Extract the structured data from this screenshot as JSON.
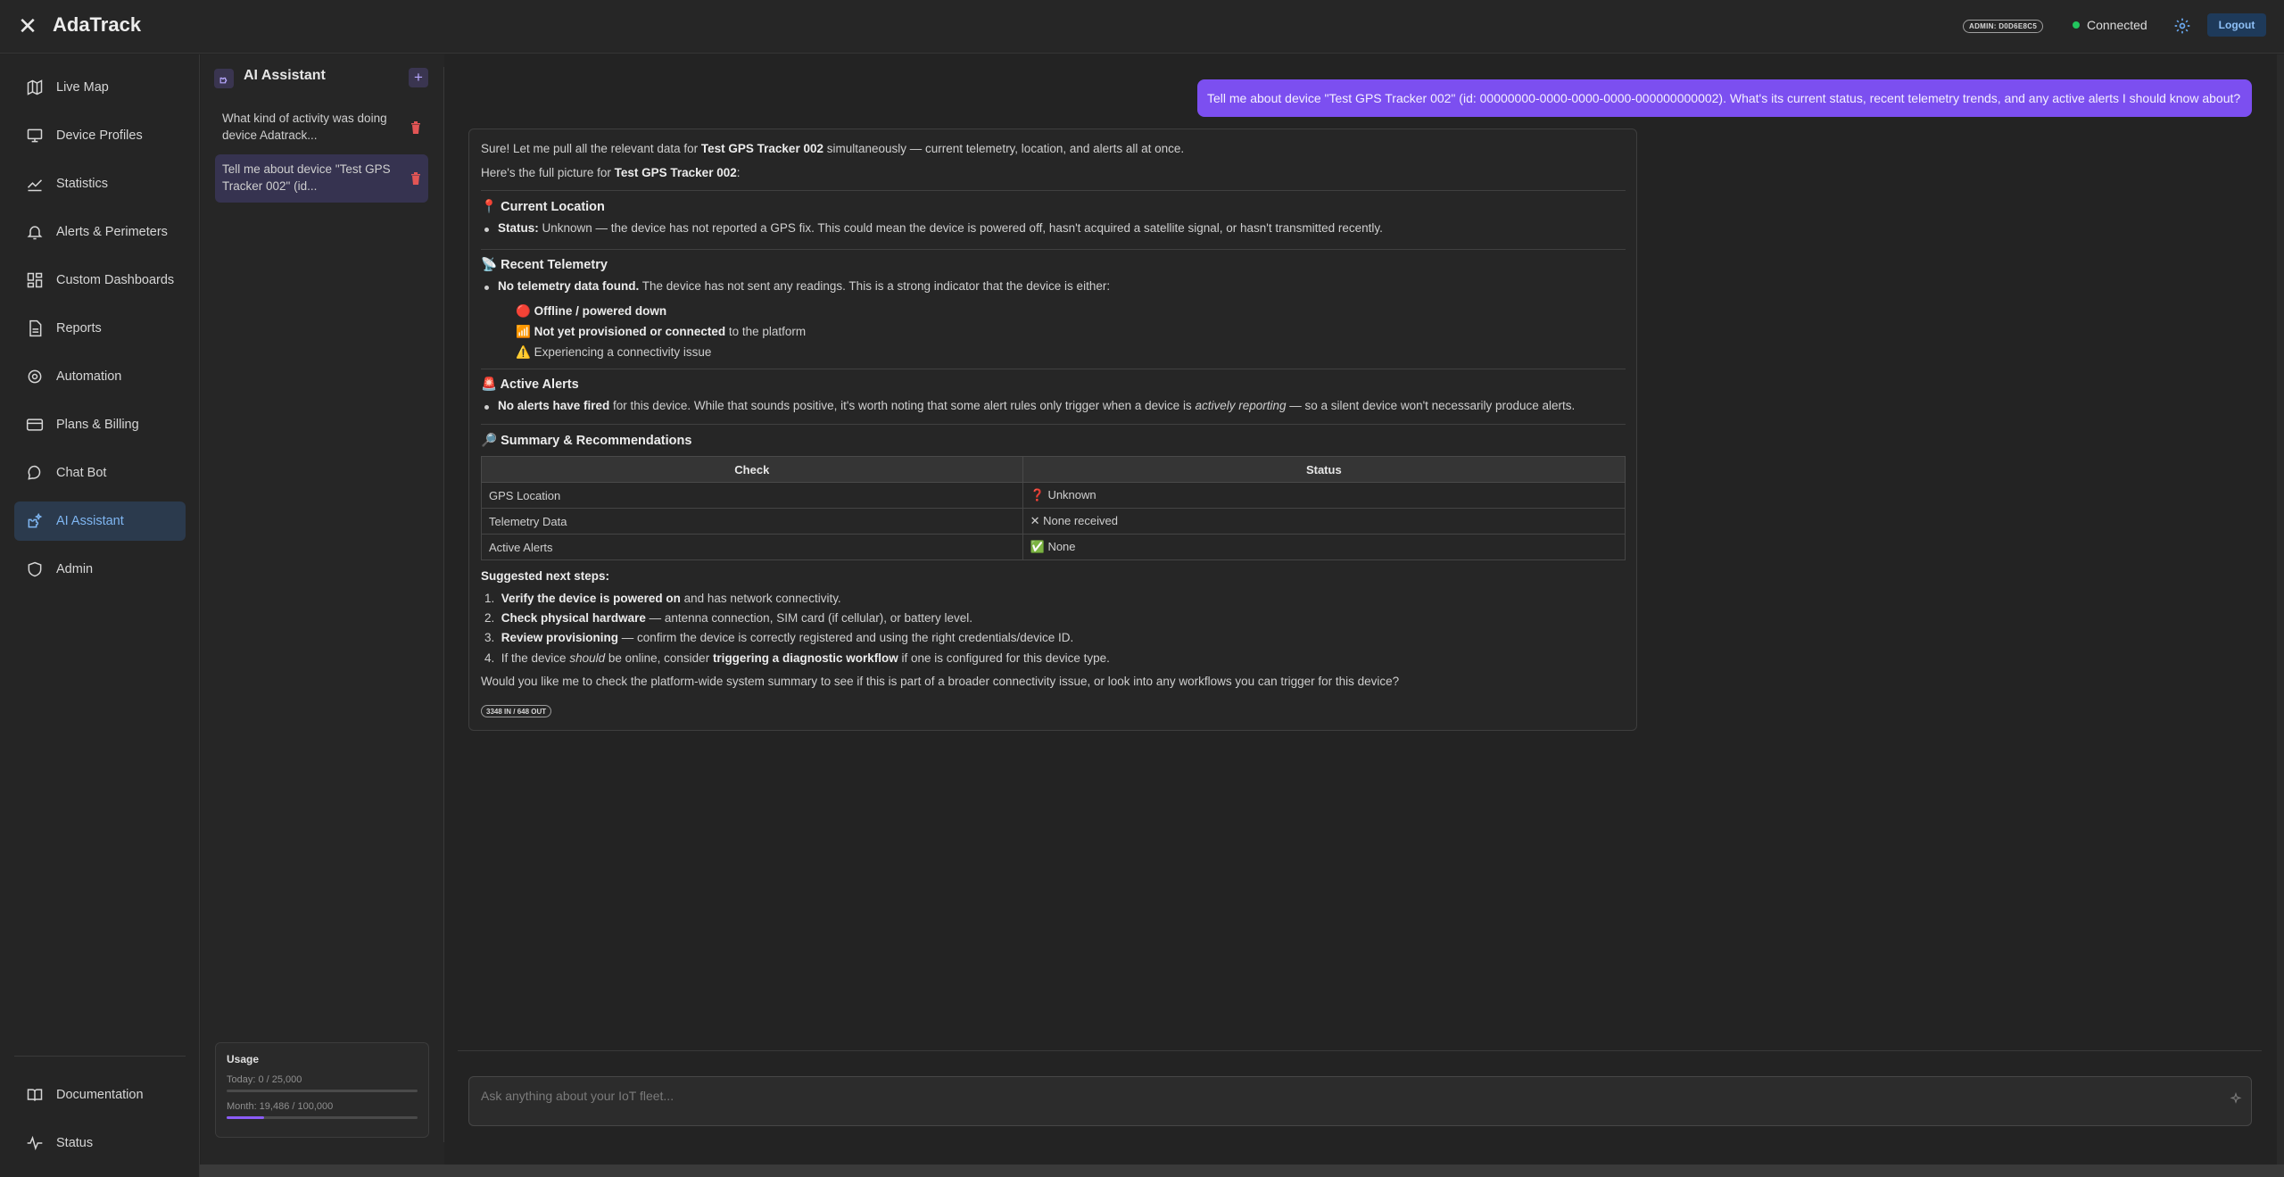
{
  "app": {
    "title": "AdaTrack"
  },
  "header": {
    "admin_badge": "ADMIN: D0D6E8C5",
    "connection_status": "Connected",
    "logout_label": "Logout",
    "accent_color": "#7c4ff0",
    "connected_color": "#22c55e"
  },
  "nav": {
    "items": [
      {
        "label": "Live Map",
        "icon": "map-icon"
      },
      {
        "label": "Device Profiles",
        "icon": "monitor-icon"
      },
      {
        "label": "Statistics",
        "icon": "trend-chart-icon"
      },
      {
        "label": "Alerts & Perimeters",
        "icon": "bell-icon"
      },
      {
        "label": "Custom Dashboards",
        "icon": "dashboard-grid-icon"
      },
      {
        "label": "Reports",
        "icon": "document-icon"
      },
      {
        "label": "Automation",
        "icon": "gear-cog-icon"
      },
      {
        "label": "Plans & Billing",
        "icon": "credit-card-icon"
      },
      {
        "label": "Chat Bot",
        "icon": "bot-icon"
      },
      {
        "label": "AI Assistant",
        "icon": "sparkle-puzzle-icon",
        "active": true
      },
      {
        "label": "Admin",
        "icon": "admin-shield-icon"
      }
    ],
    "bottom": [
      {
        "label": "Documentation",
        "icon": "book-icon"
      },
      {
        "label": "Status",
        "icon": "activity-pulse-icon"
      }
    ]
  },
  "conversations": {
    "title": "AI Assistant",
    "items": [
      {
        "line1": "What kind of activity was doing",
        "line2": "device Adatrack..."
      },
      {
        "line1": "Tell me about device \"Test GPS",
        "line2": "Tracker 002\" (id...",
        "active": true
      }
    ]
  },
  "usage": {
    "title": "Usage",
    "today": "Today: 0 / 25,000",
    "today_fraction": 0,
    "month": "Month: 19,486 / 100,000",
    "month_fraction": 0.19486
  },
  "chat": {
    "user_message": "Tell me about device \"Test GPS Tracker 002\" (id: 00000000-0000-0000-0000-000000000002). What's its current status, recent telemetry trends, and any active alerts I should know about?",
    "reply": {
      "intro_1a": "Sure! Let me pull all the relevant data for ",
      "intro_1b": "Test GPS Tracker 002",
      "intro_1c": " simultaneously — current telemetry, location, and alerts all at once.",
      "intro_2a": "Here's the full picture for ",
      "intro_2b": "Test GPS Tracker 002",
      "intro_2c": ":",
      "loc_emoji": "📍",
      "loc_heading": "Current Location",
      "loc_label": "Status:",
      "loc_text": " Unknown — the device has not reported a GPS fix. This could mean the device is powered off, hasn't acquired a satellite signal, or hasn't transmitted recently.",
      "tel_emoji": "📡",
      "tel_heading": "Recent Telemetry",
      "tel_bold": "No telemetry data found.",
      "tel_text": " The device has not sent any readings. This is a strong indicator that the device is either:",
      "tel_sub1_emoji": "🔴",
      "tel_sub1": "Offline / powered down",
      "tel_sub2_emoji": "📶",
      "tel_sub2_bold": "Not yet provisioned or connected",
      "tel_sub2_text": " to the platform",
      "tel_sub3_emoji": "⚠️",
      "tel_sub3": "Experiencing a connectivity issue",
      "alert_emoji": "🚨",
      "alert_heading": "Active Alerts",
      "alert_bold": "No alerts have fired",
      "alert_text_a": " for this device. While that sounds positive, it's worth noting that some alert rules only trigger when a device is ",
      "alert_italic": "actively reporting",
      "alert_text_b": " — so a silent device won't necessarily produce alerts.",
      "sum_emoji": "🔎",
      "sum_heading": "Summary & Recommendations",
      "table": {
        "headers": [
          "Check",
          "Status"
        ],
        "rows": [
          [
            "GPS Location",
            "❓ Unknown"
          ],
          [
            "Telemetry Data",
            "✕ None received"
          ],
          [
            "Active Alerts",
            "✅ None"
          ]
        ]
      },
      "steps_heading": "Suggested next steps:",
      "step1_bold": "Verify the device is powered on",
      "step1_text": " and has network connectivity.",
      "step2_bold": "Check physical hardware",
      "step2_text": " — antenna connection, SIM card (if cellular), or battery level.",
      "step3_bold": "Review provisioning",
      "step3_text": " — confirm the device is correctly registered and using the right credentials/device ID.",
      "step4_a": "If the device ",
      "step4_italic": "should",
      "step4_b": " be online, consider ",
      "step4_bold": "triggering a diagnostic workflow",
      "step4_c": " if one is configured for this device type.",
      "closing": "Would you like me to check the platform-wide system summary to see if this is part of a broader connectivity issue, or look into any workflows you can trigger for this device?",
      "token_badge": "3348 IN / 648 OUT"
    }
  },
  "composer": {
    "placeholder": "Ask anything about your IoT fleet..."
  }
}
